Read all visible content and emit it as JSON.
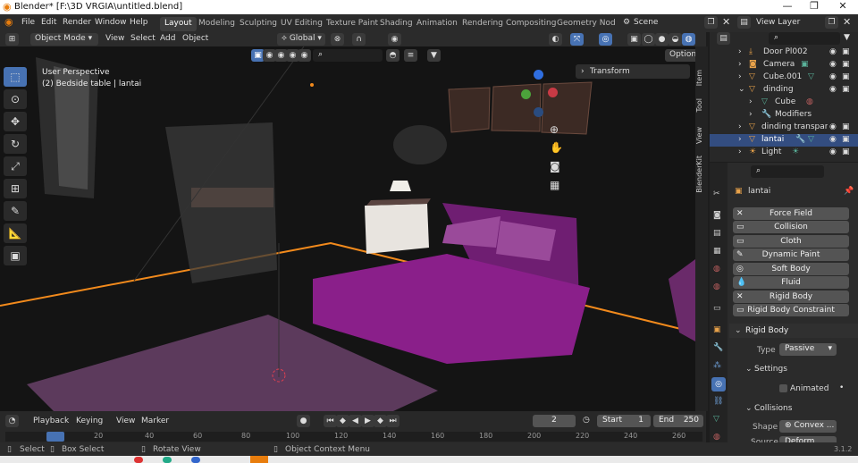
{
  "window": {
    "title": "Blender* [F:\\3D VRGIA\\untitled.blend]"
  },
  "menu": [
    "File",
    "Edit",
    "Render",
    "Window",
    "Help"
  ],
  "workspaces": [
    "Layout",
    "Modeling",
    "Sculpting",
    "UV Editing",
    "Texture Paint",
    "Shading",
    "Animation",
    "Rendering",
    "Compositing",
    "Geometry Nod"
  ],
  "scene": "Scene",
  "view_layer": "View Layer",
  "header": {
    "mode": "Object Mode",
    "menus": [
      "View",
      "Select",
      "Add",
      "Object"
    ],
    "orientation": "Global",
    "options": "Options"
  },
  "viewport": {
    "perspective": "User Perspective",
    "object": "(2) Bedside table | lantai",
    "transform_panel": "Transform"
  },
  "ntabs": [
    "Item",
    "Tool",
    "View",
    "BlenderKit"
  ],
  "outliner": {
    "items": [
      {
        "label": "Door Pl002",
        "indent": 1
      },
      {
        "label": "Camera",
        "indent": 0
      },
      {
        "label": "Cube.001",
        "indent": 0
      },
      {
        "label": "dinding",
        "indent": 0
      },
      {
        "label": "Cube",
        "indent": 1
      },
      {
        "label": "Modifiers",
        "indent": 1
      },
      {
        "label": "dinding transpara",
        "indent": 0
      },
      {
        "label": "lantai",
        "indent": 0,
        "selected": true
      },
      {
        "label": "Light",
        "indent": 0
      }
    ]
  },
  "properties": {
    "object_name": "lantai",
    "physics_buttons": [
      "Force Field",
      "Collision",
      "Cloth",
      "Dynamic Paint",
      "Soft Body",
      "Fluid",
      "Rigid Body",
      "Rigid Body Constraint"
    ],
    "rigid_body": {
      "header": "Rigid Body",
      "type_label": "Type",
      "type_value": "Passive",
      "settings": "Settings",
      "animated": "Animated",
      "collisions": "Collisions",
      "shape_label": "Shape",
      "shape_value": "Convex ...",
      "source_label": "Source",
      "source_value": "Deform"
    }
  },
  "timeline": {
    "menus": [
      "Playback",
      "Keying",
      "View",
      "Marker"
    ],
    "current_frame": "2",
    "start_label": "Start",
    "start": "1",
    "end_label": "End",
    "end": "250",
    "ticks": [
      "20",
      "40",
      "60",
      "80",
      "100",
      "120",
      "140",
      "160",
      "180",
      "200",
      "220",
      "240",
      "260"
    ]
  },
  "status": {
    "select": "Select",
    "box_select": "Box Select",
    "rotate": "Rotate View",
    "context": "Object Context Menu",
    "version": "3.1.2"
  },
  "colors": {
    "accent": "#4772b3",
    "selection_outline": "#f28a1c",
    "bed": "#8a1f8a"
  }
}
